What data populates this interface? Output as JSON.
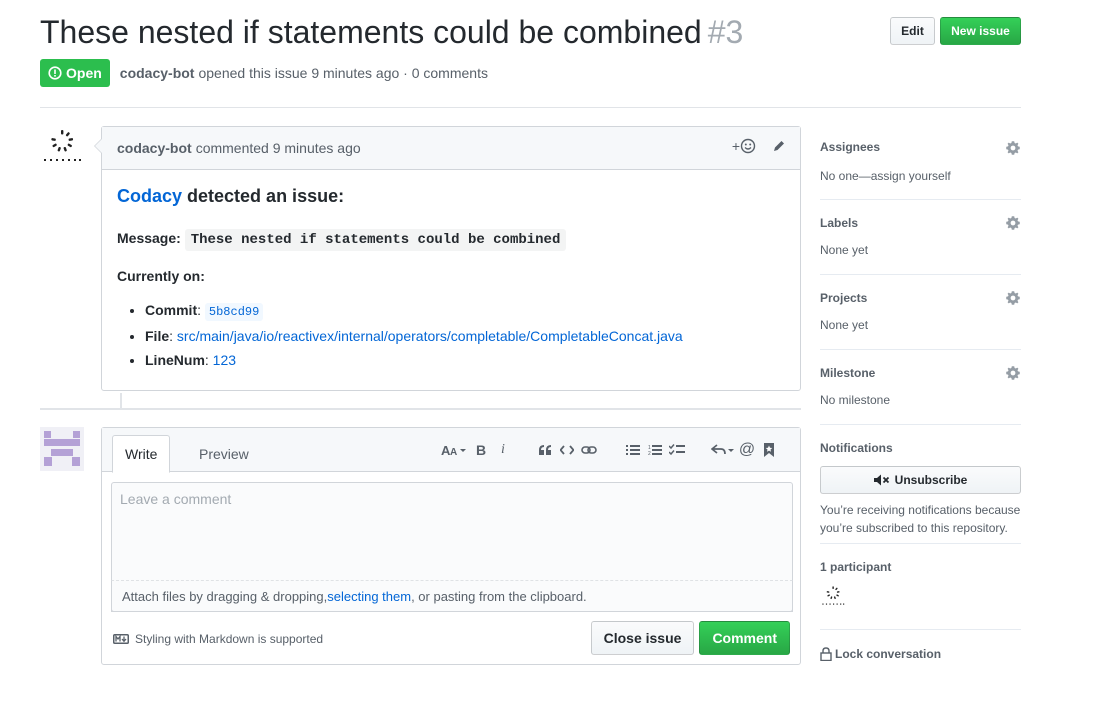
{
  "header": {
    "title": "These nested if statements could be combined",
    "number": "#3",
    "edit_label": "Edit",
    "new_issue_label": "New issue",
    "state_label": "Open",
    "author": "codacy-bot",
    "opened_text": "opened this issue 9 minutes ago · 0 comments"
  },
  "comment": {
    "author": "codacy-bot",
    "time_text": "commented 9 minutes ago",
    "reaction_label": "+",
    "heading_link": "Codacy",
    "heading_rest": " detected an issue:",
    "message_label": "Message:",
    "message_code": "These nested if statements could be combined",
    "currently_on": "Currently on:",
    "items": [
      {
        "label": "Commit",
        "sep": ": ",
        "value": "5b8cd99"
      },
      {
        "label": "File",
        "sep": ": ",
        "value": "src/main/java/io/reactivex/internal/operators/completable/CompletableConcat.java"
      },
      {
        "label": "LineNum",
        "sep": ": ",
        "value": "123"
      }
    ]
  },
  "form": {
    "tab_write": "Write",
    "tab_preview": "Preview",
    "placeholder": "Leave a comment",
    "attach_pre": "Attach files by dragging & dropping, ",
    "attach_link": "selecting them",
    "attach_post": ", or pasting from the clipboard.",
    "markdown_note": "Styling with Markdown is supported",
    "close_label": "Close issue",
    "comment_label": "Comment",
    "toolbar_icons": [
      "text-size-icon",
      "bold-icon",
      "italic-icon",
      "quote-icon",
      "code-icon",
      "link-icon",
      "unordered-list-icon",
      "ordered-list-icon",
      "task-list-icon",
      "reply-icon",
      "mention-icon",
      "bookmark-icon"
    ]
  },
  "sidebar": {
    "assignees_title": "Assignees",
    "assignees_value": "No one—assign yourself",
    "labels_title": "Labels",
    "labels_value": "None yet",
    "projects_title": "Projects",
    "projects_value": "None yet",
    "milestone_title": "Milestone",
    "milestone_value": "No milestone",
    "notifications_title": "Notifications",
    "unsubscribe_label": "Unsubscribe",
    "notifications_text": "You’re receiving notifications because you’re subscribed to this repository.",
    "participants_title": "1 participant",
    "lock_label": "Lock conversation"
  },
  "colors": {
    "accent_green": "#2cbe4e",
    "link_blue": "#0366d6",
    "muted": "#586069",
    "border": "#d1d5da"
  }
}
